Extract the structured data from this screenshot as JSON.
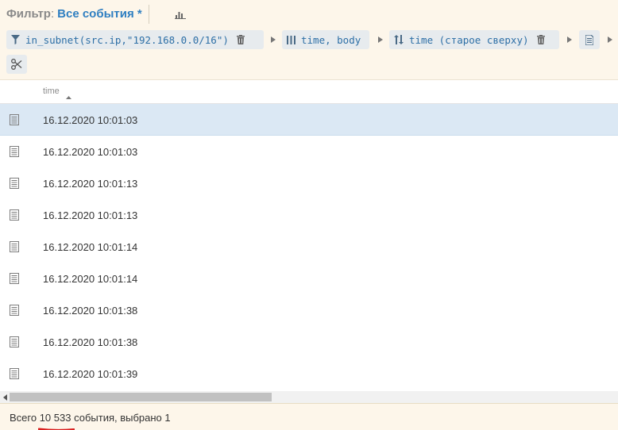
{
  "header": {
    "filter_label": "Фильтр",
    "filter_colon": ":",
    "filter_name": "Все события *"
  },
  "query_bar": {
    "filter_chip": "in_subnet(src.ip,\"192.168.0.0/16\")",
    "columns_chip": "time, body",
    "sort_chip": "time (старое сверху)"
  },
  "icons": {
    "chart": "bar-chart-icon",
    "filter": "funnel-icon",
    "columns": "columns-icon",
    "sort": "sort-arrows-icon",
    "trash": "trash-icon",
    "export": "document-icon",
    "cut": "scissors-icon",
    "row_doc": "document-lines-icon"
  },
  "table": {
    "column_header": "time",
    "rows": [
      "16.12.2020 10:01:03",
      "16.12.2020 10:01:03",
      "16.12.2020 10:01:13",
      "16.12.2020 10:01:13",
      "16.12.2020 10:01:14",
      "16.12.2020 10:01:14",
      "16.12.2020 10:01:38",
      "16.12.2020 10:01:38",
      "16.12.2020 10:01:39"
    ],
    "selected_row_index": 0
  },
  "status": {
    "prefix": "Всего ",
    "count": "10 533",
    "suffix": " события, выбрано 1"
  },
  "colors": {
    "panel_bg": "#fdf6ea",
    "accent_blue": "#2f7fc1",
    "chip_bg": "#e7ebee",
    "selected_row": "#dbe8f4",
    "annotation_red": "#d91f1f"
  }
}
